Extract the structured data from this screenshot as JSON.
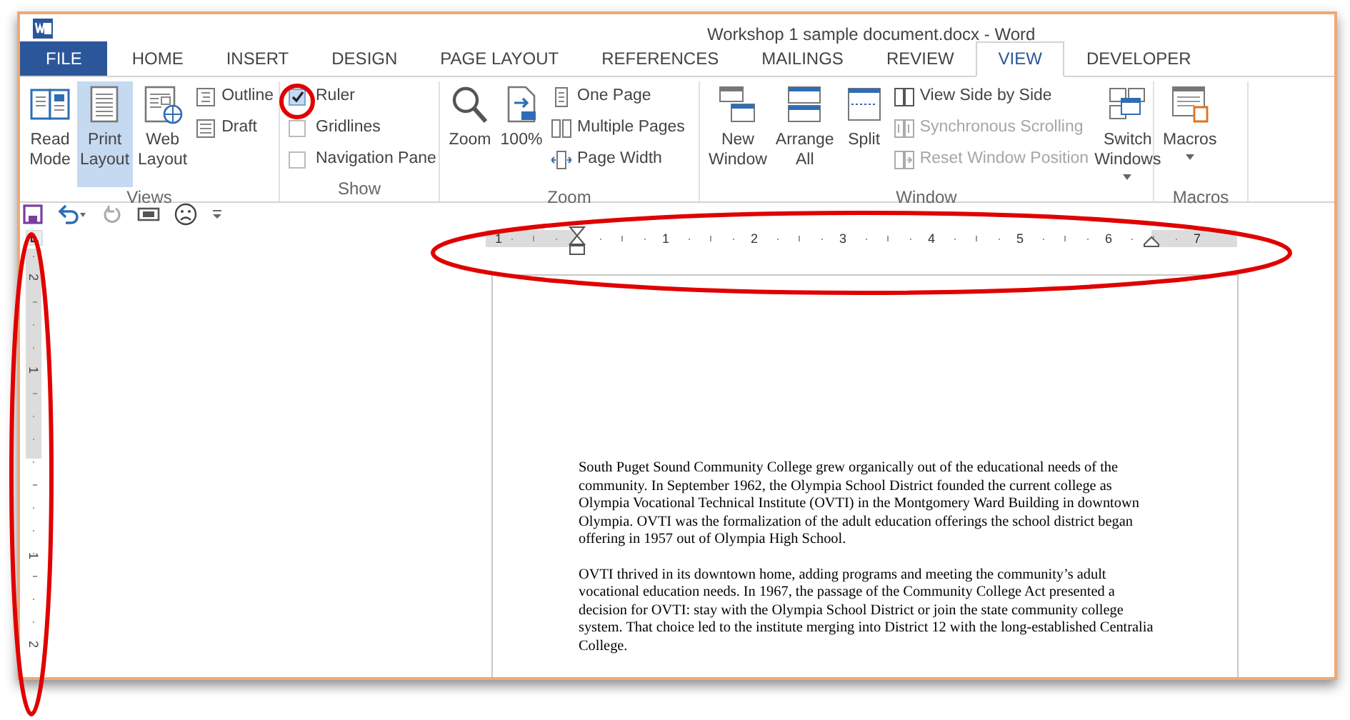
{
  "window": {
    "title": "Workshop 1 sample document.docx - Word"
  },
  "tabs": [
    {
      "label": "FILE",
      "selected": false,
      "kind": "file"
    },
    {
      "label": "HOME",
      "selected": false
    },
    {
      "label": "INSERT",
      "selected": false
    },
    {
      "label": "DESIGN",
      "selected": false
    },
    {
      "label": "PAGE LAYOUT",
      "selected": false
    },
    {
      "label": "REFERENCES",
      "selected": false
    },
    {
      "label": "MAILINGS",
      "selected": false
    },
    {
      "label": "REVIEW",
      "selected": false
    },
    {
      "label": "VIEW",
      "selected": true
    },
    {
      "label": "DEVELOPER",
      "selected": false
    }
  ],
  "ribbon": {
    "groups": [
      {
        "label": "Views",
        "items": [
          {
            "kind": "large",
            "label": "Read Mode",
            "selected": false
          },
          {
            "kind": "large",
            "label": "Print Layout",
            "selected": true
          },
          {
            "kind": "large",
            "label": "Web Layout",
            "selected": false
          },
          {
            "kind": "small",
            "label": "Outline",
            "disabled": false
          },
          {
            "kind": "small",
            "label": "Draft",
            "disabled": false
          }
        ]
      },
      {
        "label": "Show",
        "items": [
          {
            "kind": "check",
            "label": "Ruler",
            "checked": true
          },
          {
            "kind": "check",
            "label": "Gridlines",
            "checked": false
          },
          {
            "kind": "check",
            "label": "Navigation Pane",
            "checked": false
          }
        ]
      },
      {
        "label": "Zoom",
        "items": [
          {
            "kind": "large",
            "label": "Zoom",
            "selected": false
          },
          {
            "kind": "large",
            "label": "100%",
            "selected": false
          },
          {
            "kind": "small",
            "label": "One Page",
            "disabled": false
          },
          {
            "kind": "small",
            "label": "Multiple Pages",
            "disabled": false
          },
          {
            "kind": "small",
            "label": "Page Width",
            "disabled": false
          }
        ]
      },
      {
        "label": "Window",
        "items": [
          {
            "kind": "large",
            "label": "New Window",
            "selected": false
          },
          {
            "kind": "large",
            "label": "Arrange All",
            "selected": false
          },
          {
            "kind": "large",
            "label": "Split",
            "selected": false
          },
          {
            "kind": "small",
            "label": "View Side by Side",
            "disabled": false
          },
          {
            "kind": "small",
            "label": "Synchronous Scrolling",
            "disabled": true
          },
          {
            "kind": "small",
            "label": "Reset Window Position",
            "disabled": true
          },
          {
            "kind": "large",
            "label": "Switch Windows",
            "selected": false,
            "dropdown": true
          }
        ]
      },
      {
        "label": "Macros",
        "items": [
          {
            "kind": "large",
            "label": "Macros",
            "selected": false,
            "dropdown": true
          }
        ]
      }
    ]
  },
  "ruler": {
    "labels": [
      "1",
      "1",
      "2",
      "3",
      "4",
      "5",
      "6",
      "7"
    ]
  },
  "vertical_ruler": {
    "labels": [
      "2",
      "1",
      "1",
      "2"
    ]
  },
  "document": {
    "paragraphs": [
      "South Puget Sound Community College grew organically out of the educational needs of the community. In September 1962, the Olympia School District founded the current college as Olympia Vocational Technical Institute (OVTI) in the Montgomery Ward Building in downtown Olympia.  OVTI was the formalization of the adult education offerings the school district began offering in 1957 out of Olympia High School.",
      "OVTI thrived in its downtown home, adding programs and meeting the community’s adult vocational education needs. In 1967, the passage of the Community College Act presented a decision for OVTI: stay with the Olympia School District or join the state community college system.  That choice led to the institute merging into District 12 with the long-established Centralia College."
    ]
  }
}
